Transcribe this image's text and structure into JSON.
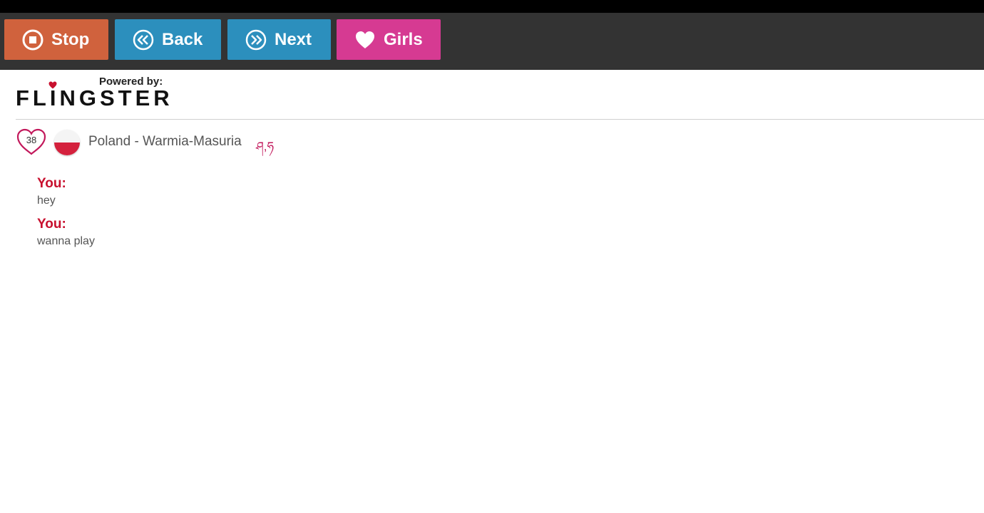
{
  "colors": {
    "stop": "#d0623d",
    "back": "#2c8fbd",
    "next": "#2c8fbd",
    "girls": "#d63a92",
    "toolbar": "#333333",
    "you_label": "#c8102e",
    "heart": "#c2185b"
  },
  "toolbar": {
    "stop_label": "Stop",
    "back_label": "Back",
    "next_label": "Next",
    "girls_label": "Girls"
  },
  "branding": {
    "powered_by": "Powered by:",
    "logo": "FLINGSTER"
  },
  "partner": {
    "age": "38",
    "location": "Poland - Warmia-Masuria",
    "language_glyph": "ཤ,ཧ",
    "flag": "poland-flag"
  },
  "chat": {
    "messages": [
      {
        "sender": "You:",
        "text": "hey"
      },
      {
        "sender": "You:",
        "text": "wanna play"
      }
    ]
  }
}
